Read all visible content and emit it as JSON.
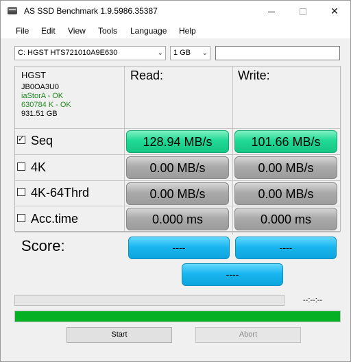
{
  "window": {
    "title": "AS SSD Benchmark 1.9.5986.35387"
  },
  "menu": [
    "File",
    "Edit",
    "View",
    "Tools",
    "Language",
    "Help"
  ],
  "controls": {
    "drive": "C: HGST HTS721010A9E630",
    "size": "1 GB",
    "text_value": ""
  },
  "drive_info": {
    "vendor": "HGST",
    "firmware": "JB0OA3U0",
    "driver": "iaStorA - OK",
    "alignment": "630784 K - OK",
    "capacity": "931.51 GB"
  },
  "columns": {
    "read": "Read:",
    "write": "Write:"
  },
  "rows": [
    {
      "label": "Seq",
      "checked": true,
      "read": "128.94 MB/s",
      "write": "101.66 MB/s"
    },
    {
      "label": "4K",
      "checked": false,
      "read": "0.00 MB/s",
      "write": "0.00 MB/s"
    },
    {
      "label": "4K-64Thrd",
      "checked": false,
      "read": "0.00 MB/s",
      "write": "0.00 MB/s"
    },
    {
      "label": "Acc.time",
      "checked": false,
      "read": "0.000 ms",
      "write": "0.000 ms"
    }
  ],
  "score": {
    "label": "Score:",
    "read": "----",
    "write": "----",
    "total": "----"
  },
  "progress": {
    "time": "--:--:--",
    "top_fraction": 0.0,
    "bottom_fraction": 1.0
  },
  "buttons": {
    "start": "Start",
    "abort": "Abort"
  },
  "colors": {
    "result_green": "#21d996",
    "result_gray": "#aaaaaa",
    "score_blue": "#1ab6f0",
    "progress_green": "#06b025"
  }
}
